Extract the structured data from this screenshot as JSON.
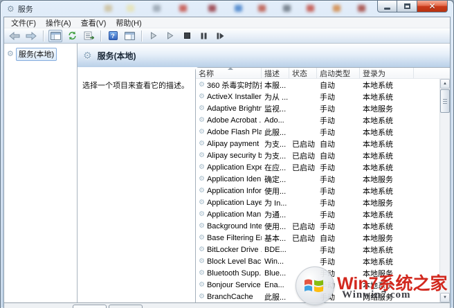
{
  "window": {
    "title": "服务"
  },
  "menu": {
    "items": [
      {
        "label": "文件(F)"
      },
      {
        "label": "操作(A)"
      },
      {
        "label": "查看(V)"
      },
      {
        "label": "帮助(H)"
      }
    ]
  },
  "toolbar": {
    "help_glyph": "?"
  },
  "sidebar": {
    "items": [
      {
        "label": "服务(本地)",
        "selected": true
      }
    ]
  },
  "main": {
    "header_title": "服务(本地)",
    "description_hint": "选择一个项目来查看它的描述。",
    "table": {
      "columns": [
        "名称",
        "描述",
        "状态",
        "启动类型",
        "登录为"
      ],
      "rows": [
        {
          "name": "360 杀毒实时防护...",
          "desc": "本服...",
          "status": "",
          "startup": "自动",
          "logon": "本地系统"
        },
        {
          "name": "ActiveX Installer ...",
          "desc": "为从 ...",
          "status": "",
          "startup": "手动",
          "logon": "本地系统"
        },
        {
          "name": "Adaptive Brightn...",
          "desc": "监视...",
          "status": "",
          "startup": "手动",
          "logon": "本地服务"
        },
        {
          "name": "Adobe Acrobat ...",
          "desc": "Ado...",
          "status": "",
          "startup": "手动",
          "logon": "本地系统"
        },
        {
          "name": "Adobe Flash Pla...",
          "desc": "此服...",
          "status": "",
          "startup": "手动",
          "logon": "本地系统"
        },
        {
          "name": "Alipay payment ...",
          "desc": "为支...",
          "status": "已启动",
          "startup": "自动",
          "logon": "本地系统"
        },
        {
          "name": "Alipay security b...",
          "desc": "为支...",
          "status": "已启动",
          "startup": "自动",
          "logon": "本地系统"
        },
        {
          "name": "Application Expe...",
          "desc": "在应...",
          "status": "已启动",
          "startup": "手动",
          "logon": "本地系统"
        },
        {
          "name": "Application Iden...",
          "desc": "确定...",
          "status": "",
          "startup": "手动",
          "logon": "本地服务"
        },
        {
          "name": "Application Infor...",
          "desc": "使用...",
          "status": "",
          "startup": "手动",
          "logon": "本地系统"
        },
        {
          "name": "Application Laye...",
          "desc": "为 In...",
          "status": "",
          "startup": "手动",
          "logon": "本地服务"
        },
        {
          "name": "Application Man...",
          "desc": "为通...",
          "status": "",
          "startup": "手动",
          "logon": "本地系统"
        },
        {
          "name": "Background Inte...",
          "desc": "使用...",
          "status": "已启动",
          "startup": "手动",
          "logon": "本地系统"
        },
        {
          "name": "Base Filtering En...",
          "desc": "基本...",
          "status": "已启动",
          "startup": "自动",
          "logon": "本地服务"
        },
        {
          "name": "BitLocker Drive ...",
          "desc": "BDE...",
          "status": "",
          "startup": "手动",
          "logon": "本地系统"
        },
        {
          "name": "Block Level Back...",
          "desc": "Win...",
          "status": "",
          "startup": "手动",
          "logon": "本地系统"
        },
        {
          "name": "Bluetooth Supp...",
          "desc": "Blue...",
          "status": "",
          "startup": "手动",
          "logon": "本地服务"
        },
        {
          "name": "Bonjour Service",
          "desc": "Ena...",
          "status": "",
          "startup": "手动",
          "logon": "本地系统"
        },
        {
          "name": "BranchCache",
          "desc": "此服...",
          "status": "",
          "startup": "手动",
          "logon": "网络服务"
        }
      ]
    }
  },
  "watermark": {
    "brand": "Win7系统之家",
    "site": "Winwin7.com"
  },
  "colors": {
    "close_button": "#c93b1d",
    "header_band": "#b9d0e8",
    "selection_border": "#84acdd",
    "watermark_red": "#d2281e",
    "flag_red": "#e24a33",
    "flag_green": "#7fba00",
    "flag_blue": "#2f9be0",
    "flag_yellow": "#ffb900"
  }
}
